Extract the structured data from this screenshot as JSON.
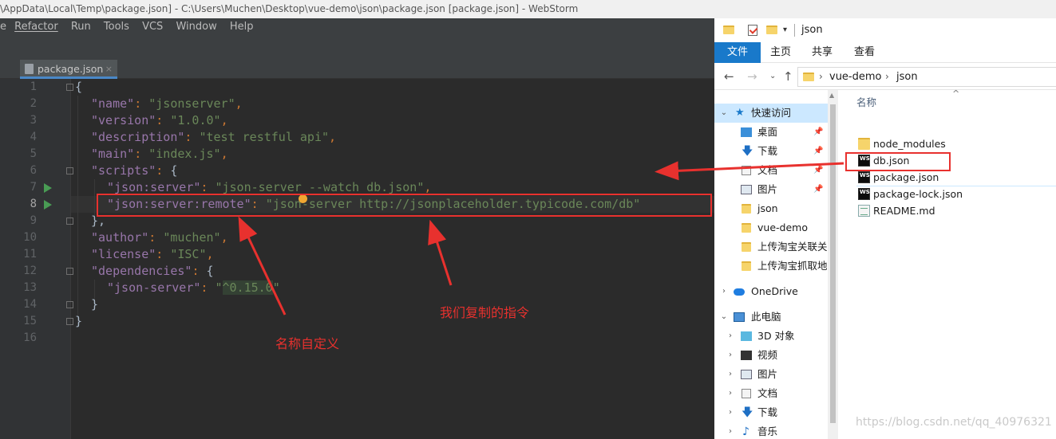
{
  "webstorm": {
    "title": "\\AppData\\Local\\Temp\\package.json] - C:\\Users\\Muchen\\Desktop\\vue-demo\\json\\package.json [package.json] - WebStorm",
    "menu": [
      "e",
      "Refactor",
      "Run",
      "Tools",
      "VCS",
      "Window",
      "Help"
    ],
    "tab_label": "package.json",
    "line_numbers": [
      "1",
      "2",
      "3",
      "4",
      "5",
      "6",
      "7",
      "8",
      "9",
      "10",
      "11",
      "12",
      "13",
      "14",
      "15",
      "16"
    ],
    "current_line": "8",
    "code": {
      "l1_brace": "{",
      "name_key": "\"name\"",
      "name_val": "\"jsonserver\"",
      "version_key": "\"version\"",
      "version_val": "\"1.0.0\"",
      "description_key": "\"description\"",
      "description_val": "\"test restful api\"",
      "main_key": "\"main\"",
      "main_val": "\"index.js\"",
      "scripts_key": "\"scripts\"",
      "script1_key": "\"json:server\"",
      "script1_val": "\"json-server --watch db.json\"",
      "script2_key": "\"json:server:remote\"",
      "script2_val": "\"json-server http://jsonplaceholder.typicode.com/db\"",
      "close_scripts": "},",
      "author_key": "\"author\"",
      "author_val": "\"muchen\"",
      "license_key": "\"license\"",
      "license_val": "\"ISC\"",
      "deps_key": "\"dependencies\"",
      "dep_key": "\"json-server\"",
      "dep_val_q1": "\"",
      "dep_val": "^0.15.0",
      "dep_val_q2": "\"",
      "close_deps": "}",
      "close_root": "}"
    }
  },
  "explorer": {
    "title": "json",
    "ribbon_tabs": [
      "文件",
      "主页",
      "共享",
      "查看"
    ],
    "address": [
      "vue-demo",
      "json"
    ],
    "column_header": "名称",
    "nav": {
      "quick_access": "快速访问",
      "items": [
        "桌面",
        "下载",
        "文档",
        "图片",
        "json",
        "vue-demo",
        "上传淘宝关联关",
        "上传淘宝抓取地:"
      ],
      "onedrive": "OneDrive",
      "this_pc": "此电脑",
      "pc_items": [
        "3D 对象",
        "视频",
        "图片",
        "文档",
        "下载",
        "音乐"
      ]
    },
    "files": [
      "node_modules",
      "db.json",
      "package.json",
      "package-lock.json",
      "README.md"
    ],
    "selected_file": "package.json"
  },
  "annotations": {
    "name_custom": "名称自定义",
    "copied_command": "我们复制的指令"
  },
  "watermark": "https://blog.csdn.net/qq_40976321",
  "colors": {
    "editor_bg": "#2b2b2b",
    "annotation_red": "#e8312e",
    "ribbon_active": "#1979ca",
    "json_key": "#9876aa",
    "json_string": "#6a8759"
  }
}
